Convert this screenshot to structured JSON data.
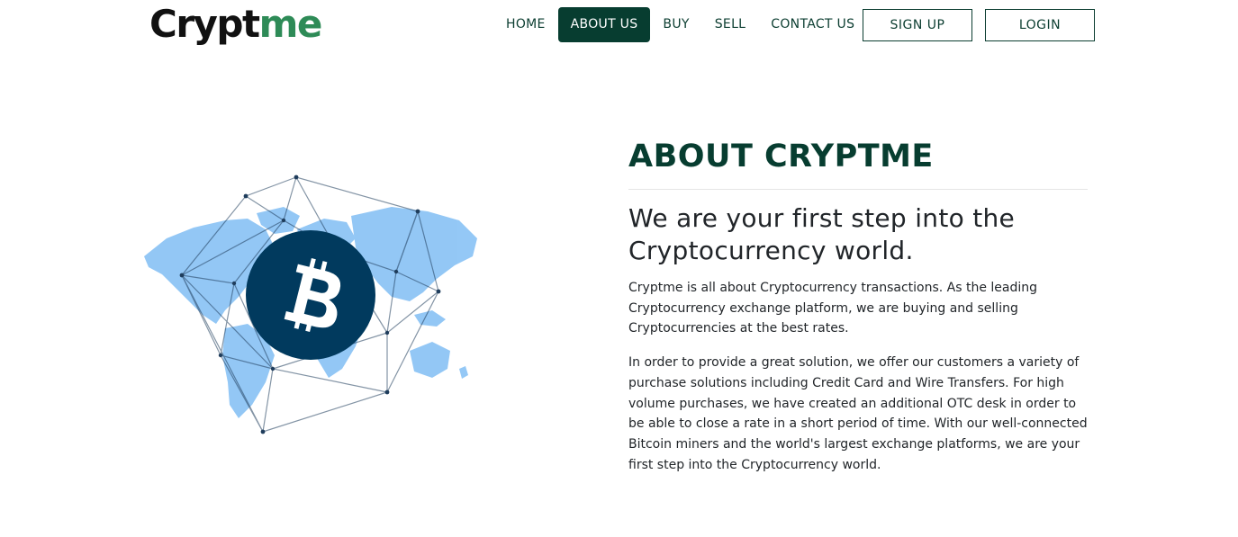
{
  "brand": {
    "logo_part1": "Crypt",
    "logo_part2": "me",
    "accent": "#073d30",
    "logo_green": "#2e8b57"
  },
  "nav": {
    "items": [
      {
        "label": "HOME",
        "active": false
      },
      {
        "label": "ABOUT US",
        "active": true
      },
      {
        "label": "BUY",
        "active": false
      },
      {
        "label": "SELL",
        "active": false
      },
      {
        "label": "CONTACT US",
        "active": false
      }
    ],
    "signup_label": "SIGN UP",
    "login_label": "LOGIN"
  },
  "illustration": {
    "icon": "bitcoin-world-network-icon"
  },
  "about": {
    "title": "ABOUT CRYPTME",
    "tagline": "We are your first step into the Cryptocurrency world.",
    "paragraph1": "Cryptme is all about Cryptocurrency transactions. As the leading Cryptocurrency exchange platform, we are buying and selling Cryptocurrencies at the best rates.",
    "paragraph2": "In order to provide a great solution, we offer our customers a variety of purchase solutions including Credit Card and Wire Transfers. For high volume purchases, we have created an additional OTC desk in order to be able to close a rate in a short period of time. With our well-connected Bitcoin miners and the world's largest exchange platforms, we are your first step into the Cryptocurrency world."
  }
}
